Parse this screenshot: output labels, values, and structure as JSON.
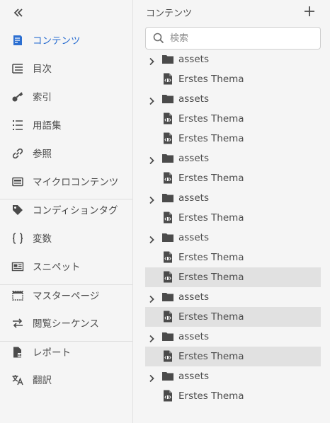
{
  "left_panel": {
    "collapse_icon": "double-chevron-left-icon",
    "items": [
      {
        "label": "コンテンツ",
        "icon": "content-icon",
        "active": true
      },
      {
        "label": "目次",
        "icon": "toc-icon"
      },
      {
        "label": "索引",
        "icon": "key-icon"
      },
      {
        "label": "用語集",
        "icon": "glossary-list-icon"
      },
      {
        "label": "参照",
        "icon": "link-icon"
      },
      {
        "label": "マイクロコンテンツ",
        "icon": "microcontent-icon"
      },
      {
        "label": "コンディションタグ",
        "icon": "tag-icon"
      },
      {
        "label": "変数",
        "icon": "braces-icon"
      },
      {
        "label": "スニペット",
        "icon": "snippet-icon"
      },
      {
        "label": "マスターページ",
        "icon": "master-page-icon"
      },
      {
        "label": "閲覧シーケンス",
        "icon": "sequence-arrows-icon"
      },
      {
        "label": "レポート",
        "icon": "report-icon"
      },
      {
        "label": "翻訳",
        "icon": "translate-icon"
      }
    ]
  },
  "right_panel": {
    "title": "コンテンツ",
    "add_icon": "plus-icon",
    "search": {
      "placeholder": "検索",
      "value": ""
    },
    "tree": [
      {
        "type": "folder",
        "label": "assets"
      },
      {
        "type": "file",
        "label": "Erstes Thema"
      },
      {
        "type": "folder",
        "label": "assets"
      },
      {
        "type": "file",
        "label": "Erstes Thema"
      },
      {
        "type": "file",
        "label": "Erstes Thema"
      },
      {
        "type": "folder",
        "label": "assets"
      },
      {
        "type": "file",
        "label": "Erstes Thema"
      },
      {
        "type": "folder",
        "label": "assets"
      },
      {
        "type": "file",
        "label": "Erstes Thema"
      },
      {
        "type": "folder",
        "label": "assets"
      },
      {
        "type": "file",
        "label": "Erstes Thema"
      },
      {
        "type": "file",
        "label": "Erstes Thema",
        "selected": true
      },
      {
        "type": "folder",
        "label": "assets"
      },
      {
        "type": "file",
        "label": "Erstes Thema",
        "selected": true
      },
      {
        "type": "folder",
        "label": "assets"
      },
      {
        "type": "file",
        "label": "Erstes Thema",
        "selected": true
      },
      {
        "type": "folder",
        "label": "assets"
      },
      {
        "type": "file",
        "label": "Erstes Thema"
      }
    ]
  },
  "colors": {
    "accent": "#2c6fd1",
    "text": "#4b4b4b",
    "selected_row": "#e1e1e1",
    "background": "#f5f5f5"
  }
}
